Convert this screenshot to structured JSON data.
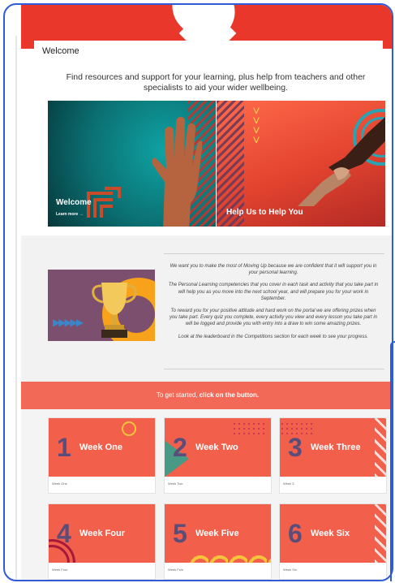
{
  "header": {
    "title": "Welcome"
  },
  "intro": {
    "text": "Find resources and support for your learning, plus help from teachers and other specialists to aid your wider wellbeing."
  },
  "hero_tiles": [
    {
      "label": "Welcome",
      "sub": "Learn more →",
      "accent": "#0b6f72"
    },
    {
      "label": "Help Us to Help You",
      "accent": "#e2432f"
    }
  ],
  "promo": {
    "paragraphs": [
      "We want you to make the most of Moving Up because we are confident that it will support you in your personal learning.",
      "The Personal Learning competencies that you cover in each task and activity that you take part in will help you as you move into the next school year, and will prepare you for your work in September.",
      "To reward you for your positive attitude and hard work on the portal we are offering prizes when you take part. Every quiz you complete, every activity you view and every lesson you take part in will be logged and provide you with entry into a draw to win some amazing prizes.",
      "Look at the leaderboard in the Competitions section for each week to see your progress."
    ]
  },
  "cta": {
    "prefix": "To get started, ",
    "bold": "click on the button."
  },
  "weeks": [
    {
      "num": "1",
      "name": "Week One",
      "caption": "Week One"
    },
    {
      "num": "2",
      "name": "Week Two",
      "caption": "Week Two"
    },
    {
      "num": "3",
      "name": "Week Three",
      "caption": "Week 3"
    },
    {
      "num": "4",
      "name": "Week Four",
      "caption": "Week Four"
    },
    {
      "num": "5",
      "name": "Week Five",
      "caption": "Week Five"
    },
    {
      "num": "6",
      "name": "Week Six",
      "caption": "Week Six"
    }
  ],
  "colors": {
    "brand_red": "#e9372c",
    "coral": "#f26a57",
    "card_coral": "#f2604b",
    "number_purple": "#5a4d7a",
    "frame_blue": "#2f5bd8"
  }
}
